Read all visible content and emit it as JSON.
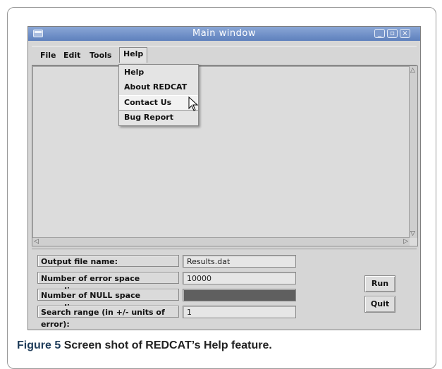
{
  "window": {
    "title": "Main window",
    "controls": [
      "_",
      "▫",
      "×"
    ]
  },
  "menubar": {
    "items": [
      "File",
      "Edit",
      "Tools",
      "Help"
    ],
    "active": "Help"
  },
  "help_menu": {
    "items": [
      "Help",
      "About REDCAT",
      "Contact Us",
      "Bug Report"
    ],
    "highlighted": "Contact Us"
  },
  "form": {
    "output_file_label": "Output file name:",
    "output_file_value": "Results.dat",
    "error_samplings_label": "Number of error space samplings:",
    "error_samplings_value": "10000",
    "null_sampling_label": "Number of NULL space sampling:",
    "null_sampling_value": "",
    "search_range_label": "Search range (in +/- units of error):",
    "search_range_value": "1"
  },
  "buttons": {
    "run": "Run",
    "quit": "Quit"
  },
  "caption": {
    "figure": "Figure 5",
    "text": "Screen shot of REDCAT’s Help feature."
  }
}
